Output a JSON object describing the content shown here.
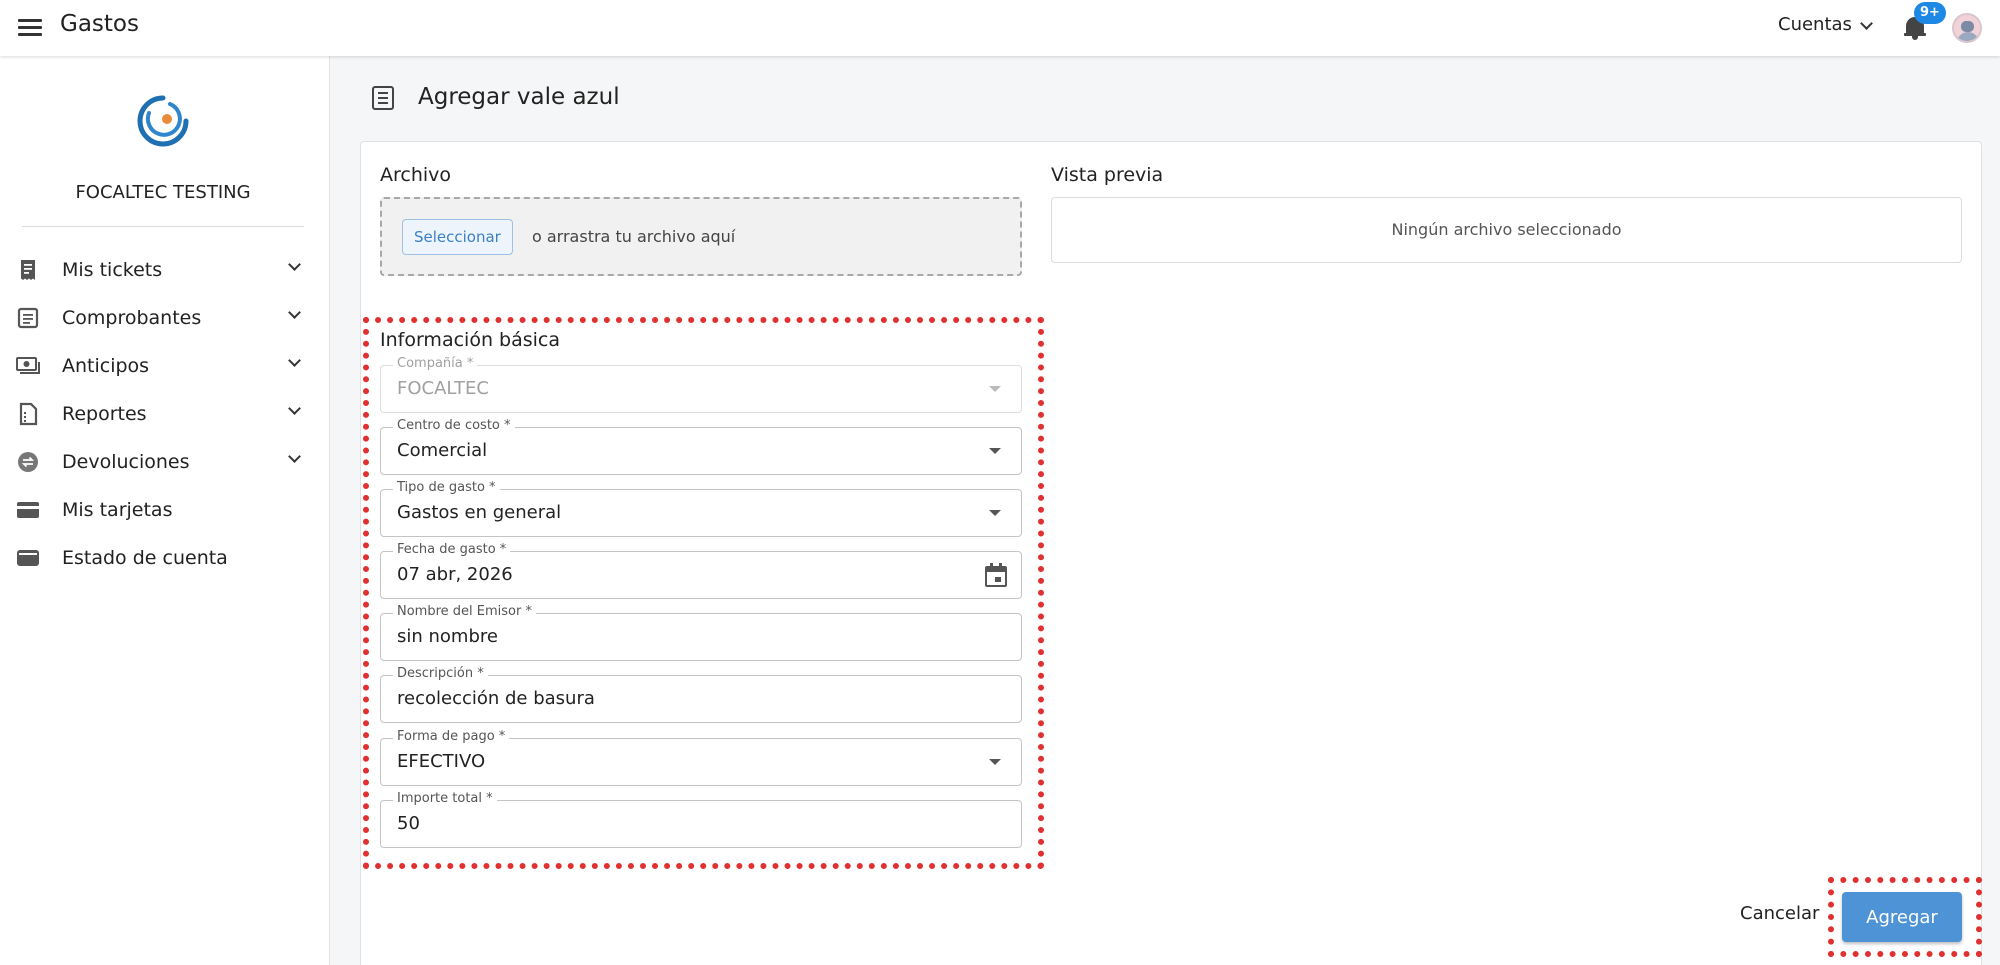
{
  "header": {
    "app_title": "Gastos",
    "accounts_label": "Cuentas",
    "notifications_badge": "9+"
  },
  "sidebar": {
    "company": "FOCALTEC TESTING",
    "items": [
      {
        "label": "Mis tickets",
        "icon": "receipt-icon",
        "expandable": true
      },
      {
        "label": "Comprobantes",
        "icon": "document-icon",
        "expandable": true
      },
      {
        "label": "Anticipos",
        "icon": "money-icon",
        "expandable": true
      },
      {
        "label": "Reportes",
        "icon": "report-icon",
        "expandable": true
      },
      {
        "label": "Devoluciones",
        "icon": "exchange-icon",
        "expandable": true
      },
      {
        "label": "Mis tarjetas",
        "icon": "card-icon",
        "expandable": false
      },
      {
        "label": "Estado de cuenta",
        "icon": "wallet-icon",
        "expandable": false
      }
    ]
  },
  "page": {
    "title": "Agregar vale azul"
  },
  "file": {
    "section_label": "Archivo",
    "select_button": "Seleccionar",
    "drop_text": "o arrastra tu archivo aquí"
  },
  "preview": {
    "section_label": "Vista previa",
    "empty_text": "Ningún archivo seleccionado"
  },
  "form": {
    "section_label": "Información básica",
    "company": {
      "label": "Compañía *",
      "value": "FOCALTEC"
    },
    "cost_center": {
      "label": "Centro de costo *",
      "value": "Comercial"
    },
    "expense_type": {
      "label": "Tipo de gasto *",
      "value": "Gastos en general"
    },
    "expense_date": {
      "label": "Fecha de gasto *",
      "value": "07 abr, 2026"
    },
    "issuer_name": {
      "label": "Nombre del Emisor *",
      "value": "sin nombre"
    },
    "description": {
      "label": "Descripción *",
      "value": "recolección de basura"
    },
    "payment_method": {
      "label": "Forma de pago *",
      "value": "EFECTIVO"
    },
    "total_amount": {
      "label": "Importe total *",
      "value": "50"
    }
  },
  "actions": {
    "cancel": "Cancelar",
    "add": "Agregar"
  },
  "colors": {
    "primary": "#4e93d6",
    "highlight": "#e03030",
    "badge": "#1e88e5"
  }
}
